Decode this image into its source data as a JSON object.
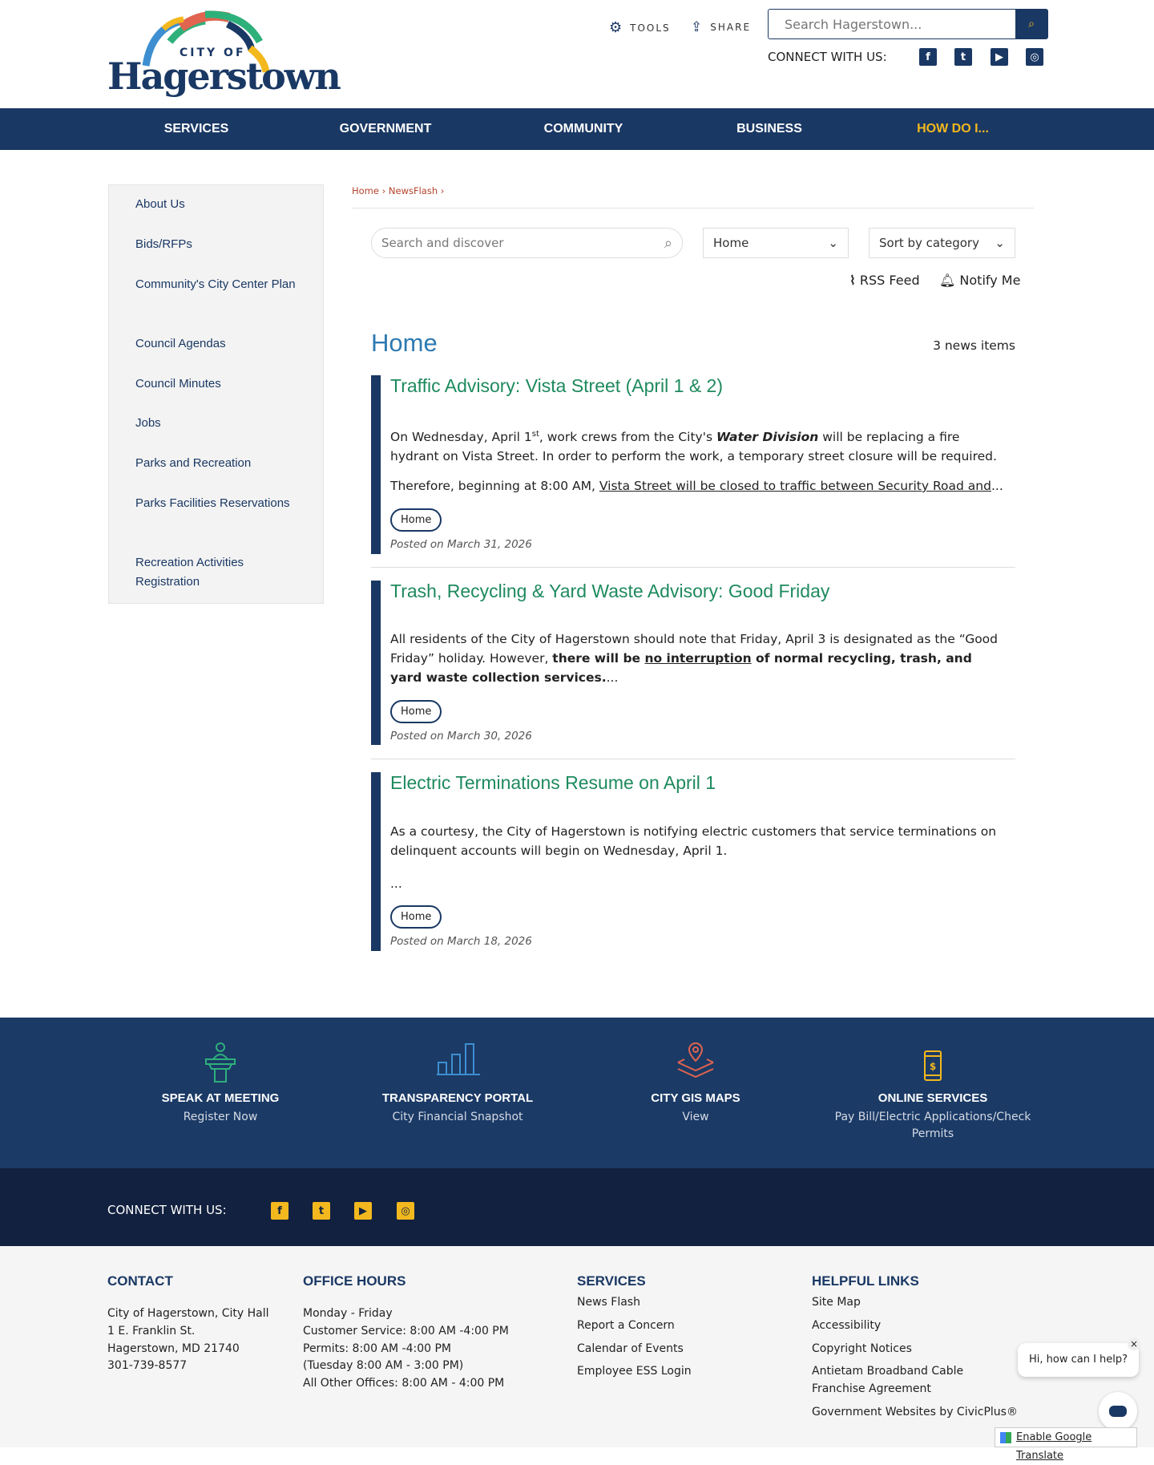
{
  "header": {
    "logo_small": "CITY OF",
    "logo_big": "Hagerstown",
    "tools": "TOOLS",
    "share": "SHARE",
    "search_placeholder": "Search Hagerstown...",
    "connect": "CONNECT WITH US:"
  },
  "nav": [
    "SERVICES",
    "GOVERNMENT",
    "COMMUNITY",
    "BUSINESS",
    "HOW DO I..."
  ],
  "sidebar": [
    "About Us",
    "Bids/RFPs",
    "Community's City Center Plan",
    "Council Agendas",
    "Council Minutes",
    "Jobs",
    "Parks and Recreation",
    "Parks Facilities Reservations",
    "Recreation Activities Registration"
  ],
  "breadcrumb": {
    "home": "Home",
    "newsflash": "NewsFlash"
  },
  "filters": {
    "search_placeholder": "Search and discover",
    "category": "Home",
    "sort": "Sort by category",
    "rss": "RSS Feed",
    "notify": "Notify Me"
  },
  "main": {
    "heading": "Home",
    "count": "3 news items"
  },
  "articles": [
    {
      "title": "Traffic Advisory: Vista Street (April 1 & 2)",
      "p1a": "On Wednesday, April 1",
      "p1sup": "st",
      "p1b": ", work crews from the City's ",
      "p1em": "Water Division",
      "p1c": " will be replacing a fire hydrant on Vista Street.  In order to perform the work, a temporary street closure will be required.",
      "p2a": "Therefore, beginning at 8:00 AM, ",
      "p2link": "Vista Street will be closed to traffic between Security Road and",
      "p2end": "...",
      "tag": "Home",
      "posted": "Posted on March 31, 2026"
    },
    {
      "title": "Trash, Recycling & Yard Waste Advisory: Good Friday",
      "p1a": "All residents of the City of Hagerstown should note that Friday, April 3 is designated as the “Good Friday” holiday.  However, ",
      "p1b": "there will be ",
      "p1u": "no interruption",
      "p1c": " of normal recycling, trash, and yard waste collection services.",
      "p1end": "...",
      "tag": "Home",
      "posted": "Posted on March 30, 2026"
    },
    {
      "title": "Electric Terminations Resume on April 1",
      "p1": "As a courtesy, the City of Hagerstown is notifying electric customers that service terminations on delinquent accounts will begin on Wednesday, April 1.",
      "p2": " ...",
      "tag": "Home",
      "posted": "Posted on March 18, 2026"
    }
  ],
  "quicklinks": [
    {
      "title": "SPEAK AT MEETING",
      "sub": "Register Now",
      "color": "#2eb07a"
    },
    {
      "title": "TRANSPARENCY PORTAL",
      "sub": "City Financial Snapshot",
      "color": "#3d8fd1"
    },
    {
      "title": "CITY GIS MAPS",
      "sub": "View",
      "color": "#e0644f"
    },
    {
      "title": "ONLINE SERVICES",
      "sub": "Pay Bill/Electric Applications/Check Permits",
      "color": "#f3b81e"
    }
  ],
  "connect": {
    "label": "CONNECT WITH US:"
  },
  "footer": {
    "contact": {
      "title": "CONTACT",
      "lines": [
        "City of Hagerstown, City Hall",
        "1 E. Franklin St.",
        "Hagerstown, MD 21740",
        "301-739-8577"
      ]
    },
    "hours": {
      "title": "OFFICE HOURS",
      "lines": [
        "Monday - Friday",
        "Customer Service: 8:00 AM -4:00 PM",
        "Permits: 8:00 AM -4:00 PM",
        "(Tuesday 8:00 AM - 3:00 PM)",
        "All Other Offices: 8:00 AM - 4:00 PM"
      ]
    },
    "services": {
      "title": "SERVICES",
      "links": [
        "News Flash",
        "Report a Concern",
        "Calendar of Events",
        "Employee ESS Login"
      ]
    },
    "helpful": {
      "title": "HELPFUL LINKS",
      "links": [
        "Site Map",
        "Accessibility",
        "Copyright Notices",
        "Antietam Broadband Cable Franchise Agreement",
        "Government Websites by CivicPlus®"
      ]
    }
  },
  "chat": {
    "bubble": "Hi, how can I help?",
    "close": "×"
  },
  "translate": "Enable Google Translate"
}
